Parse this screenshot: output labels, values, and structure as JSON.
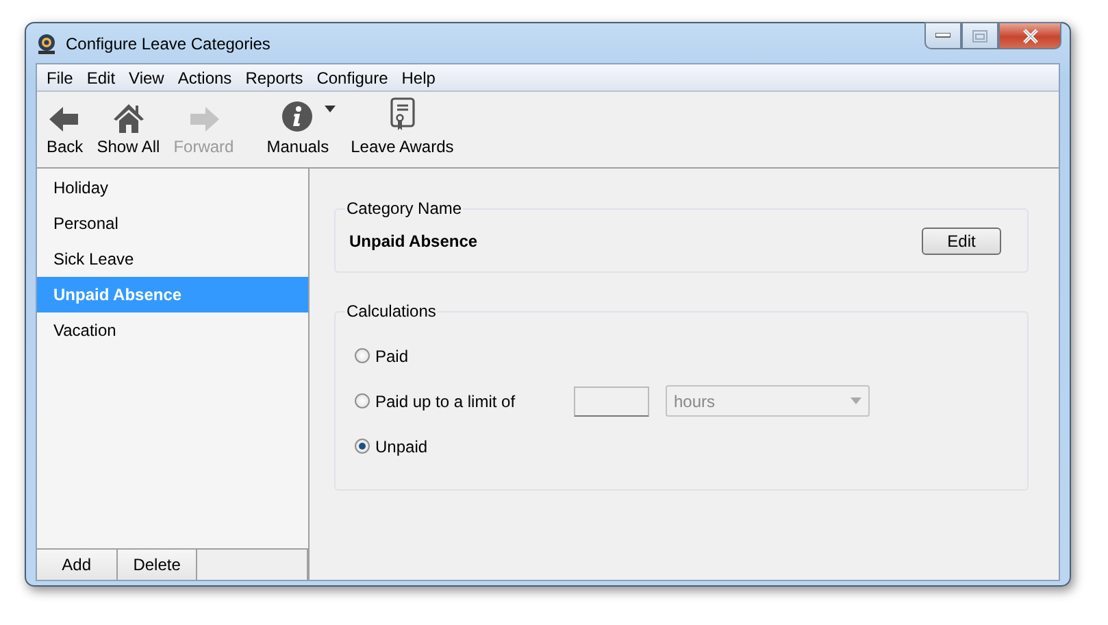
{
  "window": {
    "title": "Configure Leave Categories"
  },
  "menu": [
    "File",
    "Edit",
    "View",
    "Actions",
    "Reports",
    "Configure",
    "Help"
  ],
  "toolbar": [
    {
      "label": "Back",
      "kind": "back",
      "disabled": false,
      "dropdown": false
    },
    {
      "label": "Show All",
      "kind": "home",
      "disabled": false,
      "dropdown": false
    },
    {
      "label": "Forward",
      "kind": "forward",
      "disabled": true,
      "dropdown": false
    },
    {
      "label": "Manuals",
      "kind": "info",
      "disabled": false,
      "dropdown": true
    },
    {
      "label": "Leave Awards",
      "kind": "certificate",
      "disabled": false,
      "dropdown": false
    }
  ],
  "categories": [
    {
      "label": "Holiday",
      "selected": false
    },
    {
      "label": "Personal",
      "selected": false
    },
    {
      "label": "Sick Leave",
      "selected": false
    },
    {
      "label": "Unpaid Absence",
      "selected": true
    },
    {
      "label": "Vacation",
      "selected": false
    }
  ],
  "sidebar_buttons": [
    "Add",
    "Delete"
  ],
  "category_group": {
    "legend": "Category Name",
    "value": "Unpaid Absence",
    "button": "Edit"
  },
  "calculations": {
    "legend": "Calculations",
    "options": [
      {
        "label": "Paid",
        "selected": false,
        "kind": "plain"
      },
      {
        "label": "Paid up to a limit of",
        "selected": false,
        "kind": "limit"
      },
      {
        "label": "Unpaid",
        "selected": true,
        "kind": "plain"
      }
    ],
    "unit_dropdown": {
      "value": "hours",
      "disabled": true
    }
  }
}
